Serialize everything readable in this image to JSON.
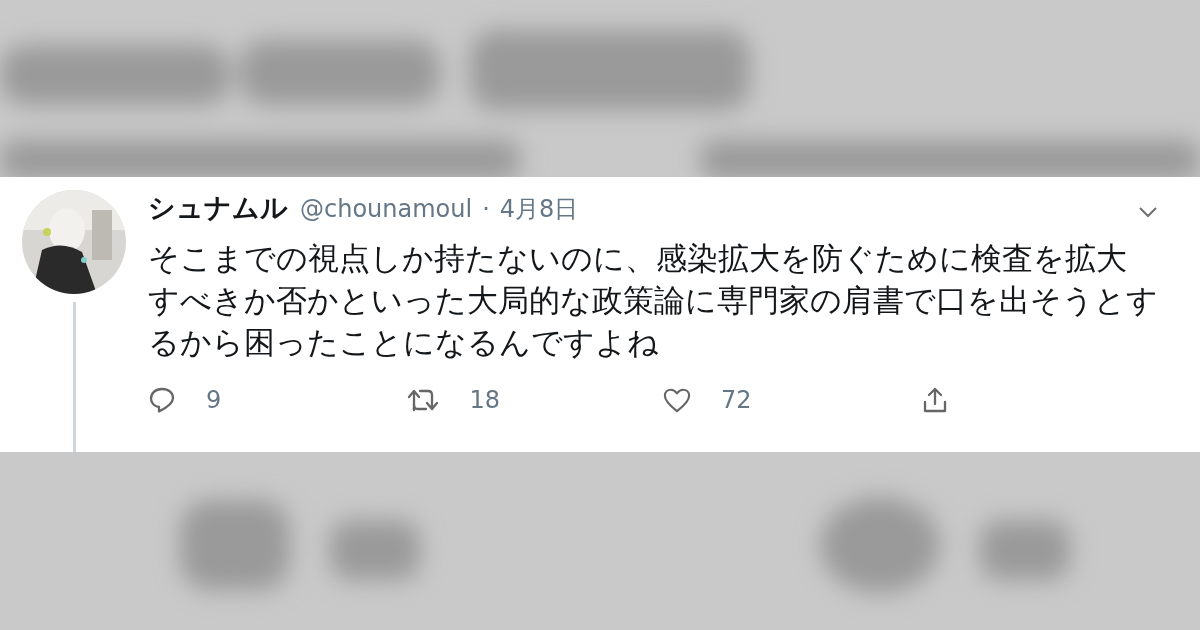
{
  "tweet": {
    "name": "シュナムル",
    "handle": "@chounamoul",
    "separator": "·",
    "date": "4月8日",
    "text": "そこまでの視点しか持たないのに、感染拡大を防ぐために検査を拡大すべきか否かといった大局的な政策論に専門家の肩書で口を出そうとするから困ったことになるんですよね",
    "actions": [
      {
        "kind": "reply",
        "count": "9"
      },
      {
        "kind": "retweet",
        "count": "18"
      },
      {
        "kind": "like",
        "count": "72"
      },
      {
        "kind": "share"
      }
    ]
  }
}
